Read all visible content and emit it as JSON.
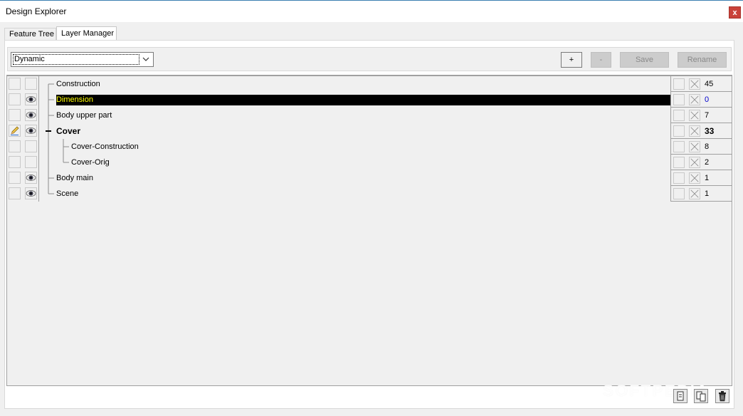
{
  "window": {
    "title": "Design Explorer",
    "close_glyph": "x"
  },
  "tabs": [
    {
      "label": "Feature Tree",
      "active": false
    },
    {
      "label": "Layer Manager",
      "active": true
    }
  ],
  "toolbar": {
    "filter_value": "Dynamic",
    "add_label": "+",
    "remove_label": "-",
    "save_label": "Save",
    "rename_label": "Rename"
  },
  "layers": [
    {
      "name": "Construction",
      "count": "45",
      "visible": false,
      "edit": false,
      "selected": false,
      "bold": false,
      "level": 0
    },
    {
      "name": "Dimension",
      "count": "0",
      "visible": true,
      "edit": false,
      "selected": true,
      "bold": false,
      "level": 0
    },
    {
      "name": "Body upper part",
      "count": "7",
      "visible": true,
      "edit": false,
      "selected": false,
      "bold": false,
      "level": 0
    },
    {
      "name": "Cover",
      "count": "33",
      "visible": true,
      "edit": true,
      "selected": false,
      "bold": true,
      "level": 0,
      "expanded": true
    },
    {
      "name": "Cover-Construction",
      "count": "8",
      "visible": false,
      "edit": false,
      "selected": false,
      "bold": false,
      "level": 1
    },
    {
      "name": "Cover-Orig",
      "count": "2",
      "visible": false,
      "edit": false,
      "selected": false,
      "bold": false,
      "level": 1
    },
    {
      "name": "Body main",
      "count": "1",
      "visible": true,
      "edit": false,
      "selected": false,
      "bold": false,
      "level": 0
    },
    {
      "name": "Scene",
      "count": "1",
      "visible": true,
      "edit": false,
      "selected": false,
      "bold": false,
      "level": 0
    }
  ],
  "icons": {
    "visible": "eye-icon",
    "edit": "pencil-icon",
    "lock": "cross-box-icon",
    "bottom": [
      "new-layer-icon",
      "copy-layer-icon",
      "trash-icon"
    ]
  },
  "colors": {
    "selected_bg": "#000000",
    "selected_fg": "#ffff00",
    "count_blue": "#0000cc",
    "close_red": "#c9423a"
  },
  "watermark": "SOFTPEDIA"
}
